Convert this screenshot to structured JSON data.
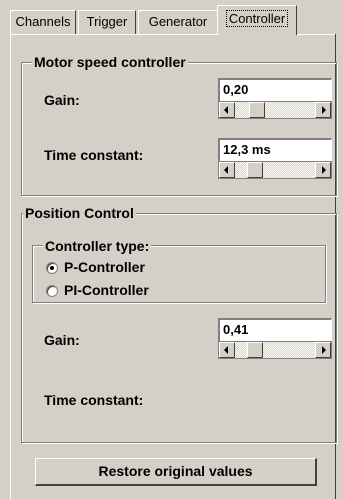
{
  "tabs": [
    {
      "label": "Channels",
      "active": false
    },
    {
      "label": "Trigger",
      "active": false
    },
    {
      "label": "Generator",
      "active": false
    },
    {
      "label": "Controller",
      "active": true
    }
  ],
  "motor_speed": {
    "title": "Motor speed controller",
    "gain_label": "Gain:",
    "gain_value": "0,20",
    "time_label": "Time constant:",
    "time_value": "12,3 ms"
  },
  "position": {
    "title": "Position Control",
    "controller_type": {
      "title": "Controller type:",
      "options": [
        "P-Controller",
        "PI-Controller"
      ],
      "selected": "P-Controller"
    },
    "gain_label": "Gain:",
    "gain_value": "0,41",
    "time_label": "Time constant:"
  },
  "restore_button": "Restore original values"
}
